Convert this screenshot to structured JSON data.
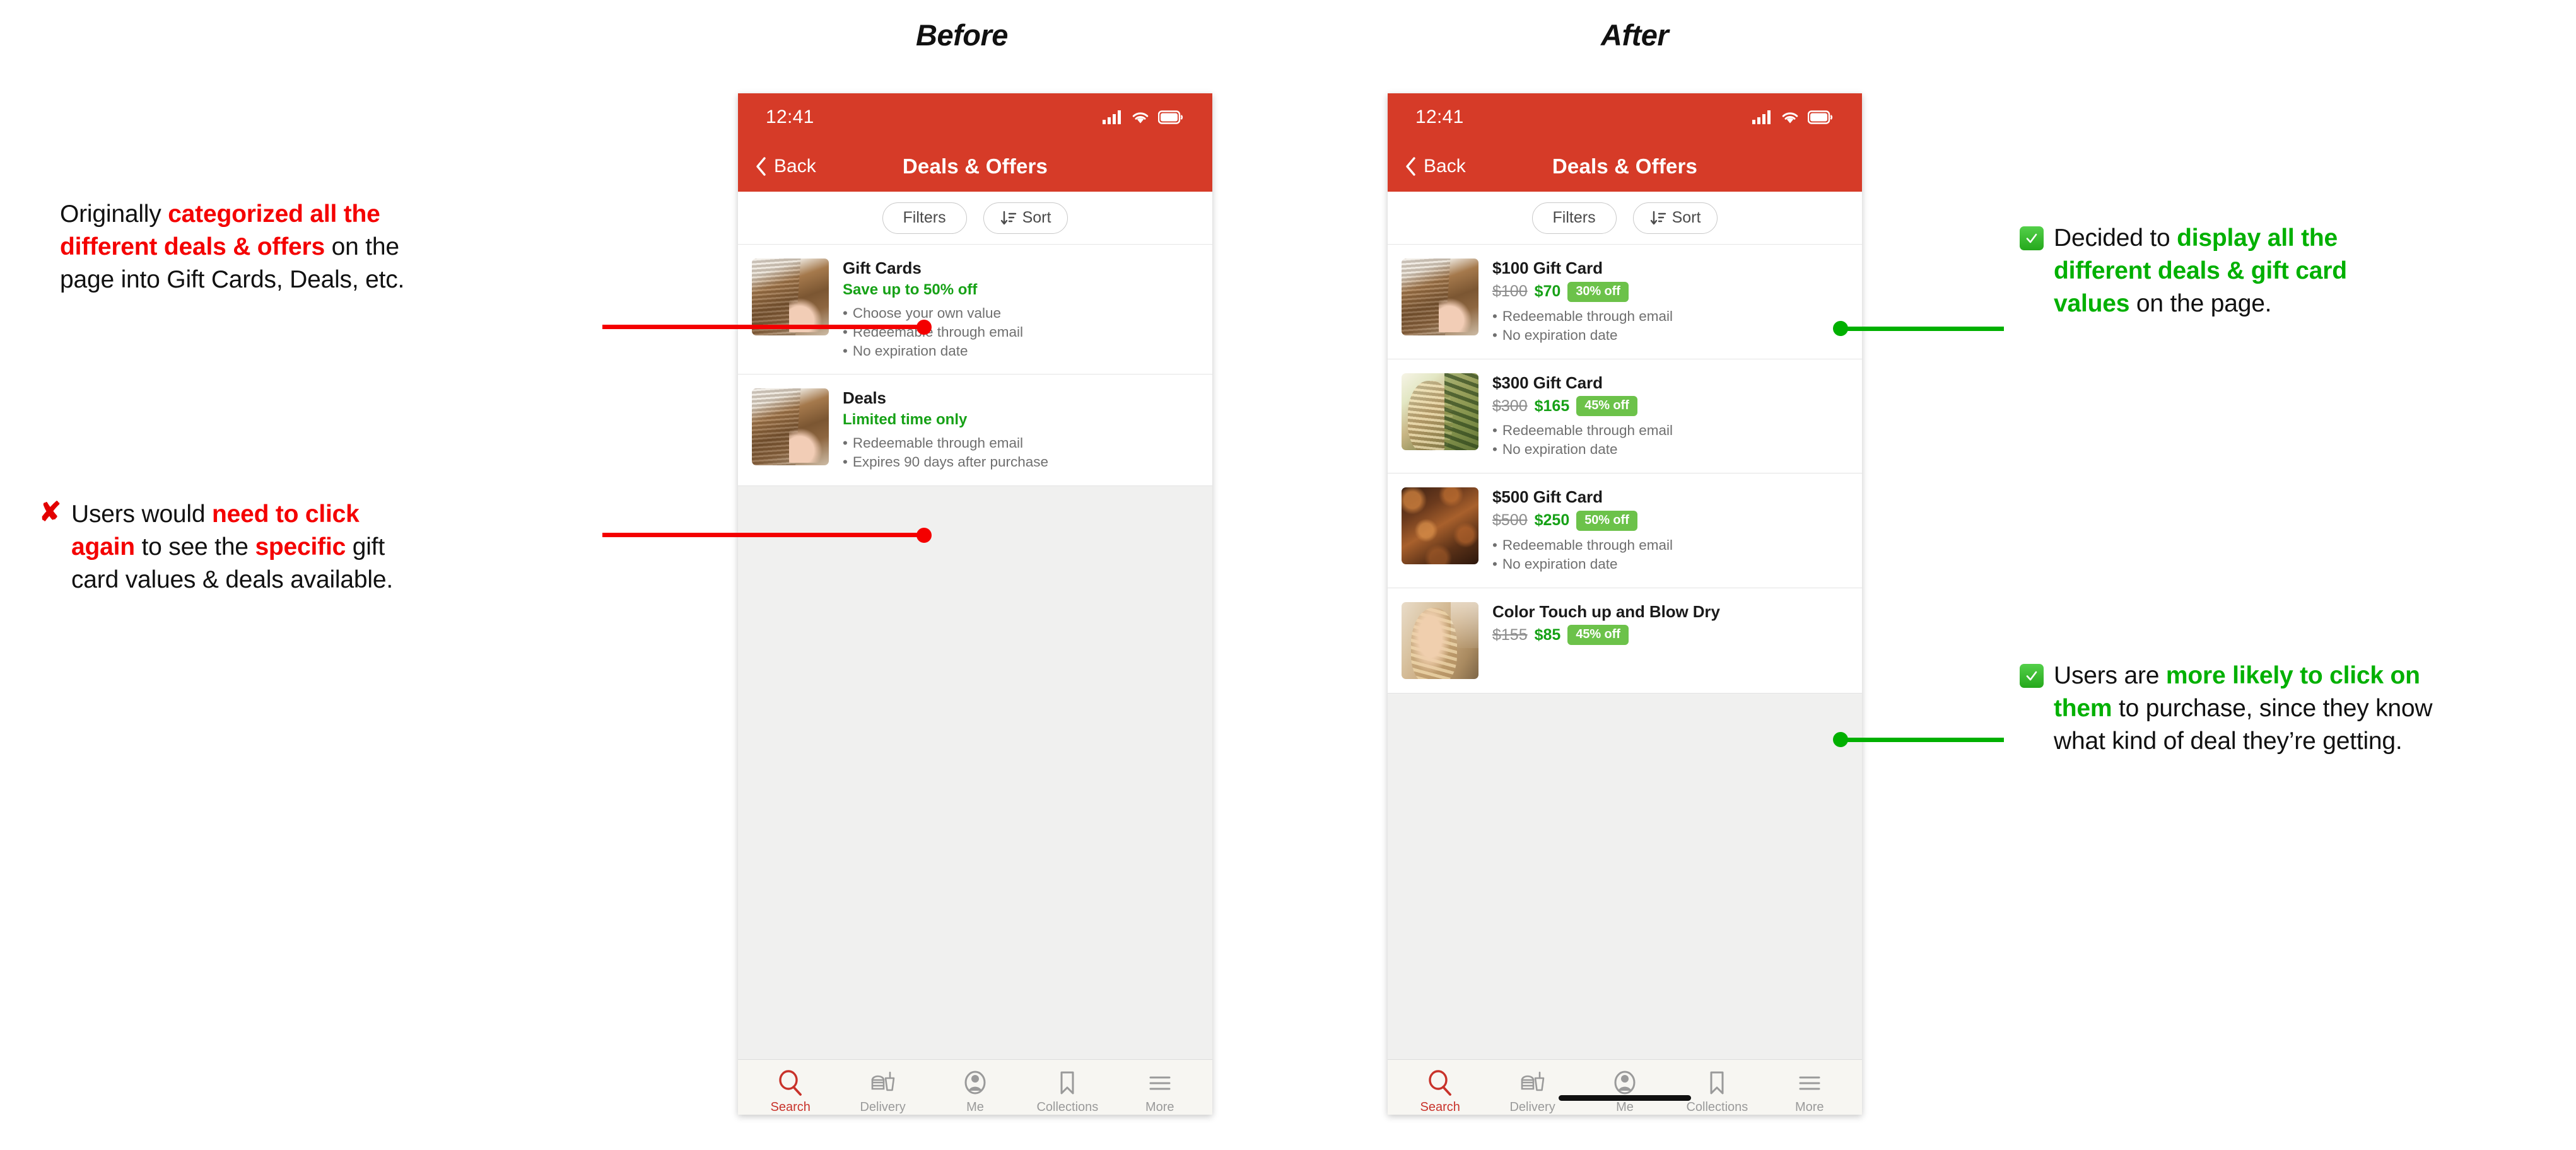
{
  "sections": {
    "before_label": "Before",
    "after_label": "After"
  },
  "phone": {
    "status_time": "12:41",
    "nav_back_label": "Back",
    "nav_title": "Deals & Offers",
    "filters_label": "Filters",
    "sort_label": "Sort"
  },
  "tabbar": {
    "items": [
      {
        "label": "Search",
        "icon": "search-icon",
        "active": true
      },
      {
        "label": "Delivery",
        "icon": "delivery-icon",
        "active": false
      },
      {
        "label": "Me",
        "icon": "person-icon",
        "active": false
      },
      {
        "label": "Collections",
        "icon": "bookmark-icon",
        "active": false
      },
      {
        "label": "More",
        "icon": "hamburger-icon",
        "active": false
      }
    ]
  },
  "before_list": [
    {
      "title": "Gift Cards",
      "subtitle": "Save up to 50% off",
      "bullets": [
        "Choose your own value",
        "Redeemable through email",
        "No expiration date"
      ],
      "image": "woman-hair-cut-scissors"
    },
    {
      "title": "Deals",
      "subtitle": "Limited time only",
      "bullets": [
        "Redeemable through email",
        "Expires 90 days after purchase"
      ],
      "image": "woman-hair-cut-scissors"
    }
  ],
  "after_list": [
    {
      "title": "$100 Gift Card",
      "price_old": "$100",
      "price_new": "$70",
      "badge": "30% off",
      "bullets": [
        "Redeemable through email",
        "No expiration date"
      ],
      "image": "woman-hair-cut-scissors"
    },
    {
      "title": "$300 Gift Card",
      "price_old": "$300",
      "price_new": "$165",
      "badge": "45% off",
      "bullets": [
        "Redeemable through email",
        "No expiration date"
      ],
      "image": "blonde-wavy-hair-outdoors"
    },
    {
      "title": "$500 Gift Card",
      "price_old": "$500",
      "price_new": "$250",
      "badge": "50% off",
      "bullets": [
        "Redeemable through email",
        "No expiration date"
      ],
      "image": "auburn-curly-hair"
    },
    {
      "title": "Color Touch up and Blow Dry",
      "price_old": "$155",
      "price_new": "$85",
      "badge": "45% off",
      "bullets": [],
      "image": "salon-color-blow-dry"
    }
  ],
  "annotations": [
    {
      "id": "annot-1",
      "marker": "none",
      "segments": [
        {
          "text": "Originally ",
          "style": "plain"
        },
        {
          "text": "categorized all the different deals & offers",
          "style": "red"
        },
        {
          "text": " on the page into Gift Cards, Deals, etc.",
          "style": "plain"
        }
      ]
    },
    {
      "id": "annot-2",
      "marker": "x",
      "marker_glyph": "✘",
      "segments": [
        {
          "text": "Users would ",
          "style": "plain"
        },
        {
          "text": "need to click again",
          "style": "red"
        },
        {
          "text": " to see the ",
          "style": "plain"
        },
        {
          "text": "specific",
          "style": "red"
        },
        {
          "text": " gift card values & deals available.",
          "style": "plain"
        }
      ]
    },
    {
      "id": "annot-3",
      "marker": "check",
      "marker_glyph": "✓",
      "segments": [
        {
          "text": "Decided to ",
          "style": "plain"
        },
        {
          "text": "display all the different deals & gift card values",
          "style": "green"
        },
        {
          "text": " on the page.",
          "style": "plain"
        }
      ]
    },
    {
      "id": "annot-4",
      "marker": "check",
      "marker_glyph": "✓",
      "segments": [
        {
          "text": "Users are ",
          "style": "plain"
        },
        {
          "text": "more likely to click on them",
          "style": "green"
        },
        {
          "text": " to purchase, since they know what kind of deal they’re getting.",
          "style": "plain"
        }
      ]
    }
  ],
  "colors": {
    "brand_red": "#D63B28",
    "annotation_red": "#F40000",
    "annotation_green": "#00B000",
    "badge_green": "#6CC24A",
    "price_green": "#16A116",
    "tab_active": "#C8322A"
  }
}
